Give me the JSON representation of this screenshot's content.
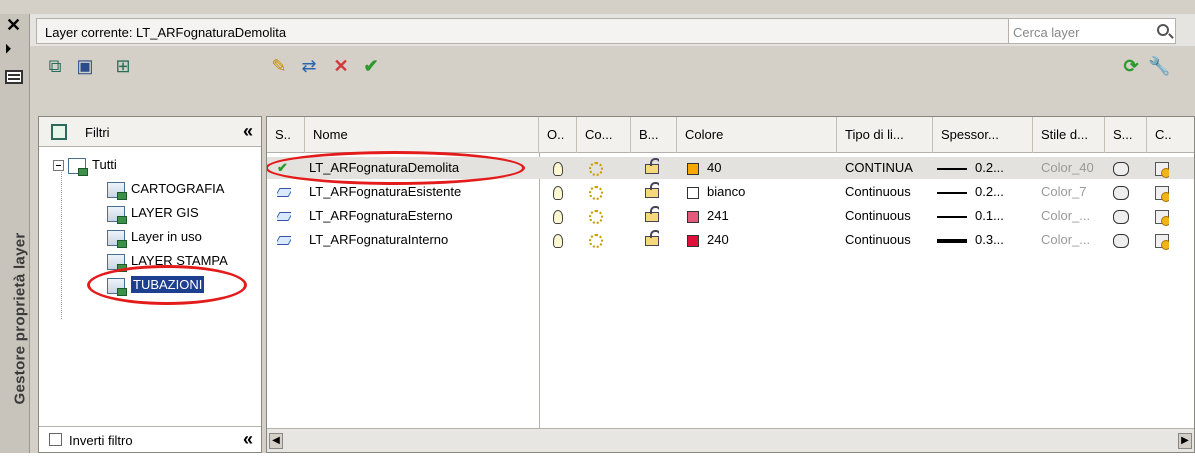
{
  "panel_title": "Gestore proprietà layer",
  "current_layer_label": "Layer corrente: LT_ARFognaturaDemolita",
  "search": {
    "placeholder": "Cerca layer"
  },
  "filters": {
    "header": "Filtri",
    "items": [
      {
        "label": "Tutti"
      },
      {
        "label": "CARTOGRAFIA"
      },
      {
        "label": "LAYER GIS"
      },
      {
        "label": "Layer in uso"
      },
      {
        "label": "LAYER STAMPA"
      },
      {
        "label": "TUBAZIONI"
      }
    ],
    "invert_label": "Inverti filtro"
  },
  "columns": [
    "S..",
    "Nome",
    "O..",
    "Co...",
    "B...",
    "Colore",
    "Tipo di li...",
    "Spessor...",
    "Stile d...",
    "S...",
    "C.."
  ],
  "layers": [
    {
      "name": "LT_ARFognaturaDemolita",
      "color_name": "40",
      "color_hex": "#f6a800",
      "linetype": "CONTINUA",
      "lineweight": "0.2...",
      "plotstyle": "Color_40"
    },
    {
      "name": "LT_ARFognaturaEsistente",
      "color_name": "bianco",
      "color_hex": "#ffffff",
      "linetype": "Continuous",
      "lineweight": "0.2...",
      "plotstyle": "Color_7"
    },
    {
      "name": "LT_ARFognaturaEsterno",
      "color_name": "241",
      "color_hex": "#e45a7d",
      "linetype": "Continuous",
      "lineweight": "0.1...",
      "plotstyle": "Color_..."
    },
    {
      "name": "LT_ARFognaturaInterno",
      "color_name": "240",
      "color_hex": "#e0103a",
      "linetype": "Continuous",
      "lineweight": "0.3...",
      "plotstyle": "Color_..."
    }
  ]
}
